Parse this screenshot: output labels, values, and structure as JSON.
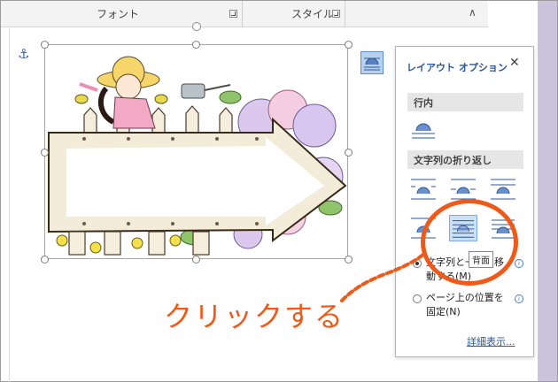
{
  "ribbon": {
    "font_group_label": "フォント",
    "style_group_label": "スタイル",
    "collapse_glyph": "∧"
  },
  "document": {
    "anchor_glyph": "⚓"
  },
  "layout_pane": {
    "title": "レイアウト オプション",
    "close_glyph": "✕",
    "section_inline": "行内",
    "section_wrap": "文字列の折り返し",
    "tooltip": "背面",
    "option_move_with_text_line1": "文字列と一緒に移",
    "option_move_with_text_line2": "動する(M)",
    "option_fix_position_line1": "ページ上の位置を",
    "option_fix_position_line2": "固定(N)",
    "info_glyph": "i",
    "more_link": "詳細表示..."
  },
  "annotation": {
    "text": "クリックする",
    "color": "#ef5a1a"
  },
  "colors": {
    "accent": "#2b579a",
    "side_panel": "#c9c4dc",
    "selected_icon_bg": "#cce0f5"
  }
}
